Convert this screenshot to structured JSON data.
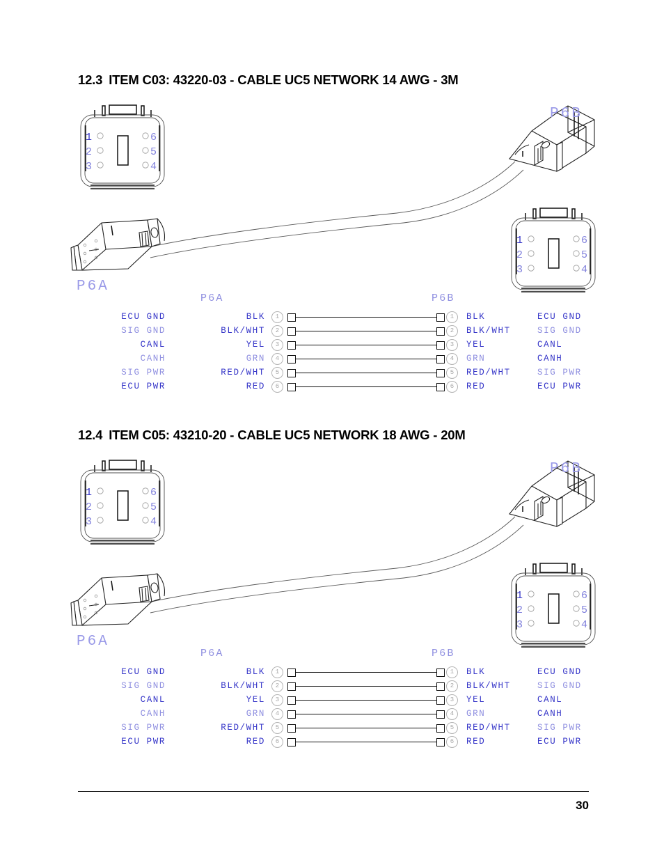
{
  "document": {
    "page_number": "30"
  },
  "sections": [
    {
      "number": "12.3",
      "title": "ITEM C03: 43220-03 - CABLE UC5 NETWORK 14 AWG - 3M",
      "connector_a_label": "P6A",
      "connector_b_label": "P6B",
      "face_pins": [
        "1",
        "2",
        "3",
        "4",
        "5",
        "6"
      ],
      "table": {
        "left_header": "P6A",
        "right_header": "P6B",
        "rows": [
          {
            "pin": "1",
            "signal": "ECU GND",
            "color": "BLK"
          },
          {
            "pin": "2",
            "signal": "SIG GND",
            "color": "BLK/WHT"
          },
          {
            "pin": "3",
            "signal": "CANL",
            "color": "YEL"
          },
          {
            "pin": "4",
            "signal": "CANH",
            "color": "GRN"
          },
          {
            "pin": "5",
            "signal": "SIG PWR",
            "color": "RED/WHT"
          },
          {
            "pin": "6",
            "signal": "ECU PWR",
            "color": "RED"
          }
        ]
      }
    },
    {
      "number": "12.4",
      "title": "ITEM C05: 43210-20 - CABLE UC5 NETWORK 18 AWG - 20M",
      "connector_a_label": "P6A",
      "connector_b_label": "P6B",
      "face_pins": [
        "1",
        "2",
        "3",
        "4",
        "5",
        "6"
      ],
      "table": {
        "left_header": "P6A",
        "right_header": "P6B",
        "rows": [
          {
            "pin": "1",
            "signal": "ECU GND",
            "color": "BLK"
          },
          {
            "pin": "2",
            "signal": "SIG GND",
            "color": "BLK/WHT"
          },
          {
            "pin": "3",
            "signal": "CANL",
            "color": "YEL"
          },
          {
            "pin": "4",
            "signal": "CANH",
            "color": "GRN"
          },
          {
            "pin": "5",
            "signal": "SIG PWR",
            "color": "RED/WHT"
          },
          {
            "pin": "6",
            "signal": "ECU PWR",
            "color": "RED"
          }
        ]
      }
    }
  ],
  "colors": {
    "label_blue": "#3535c8",
    "label_blue_light": "#8f8fe0",
    "line": "#4d4d4d"
  }
}
